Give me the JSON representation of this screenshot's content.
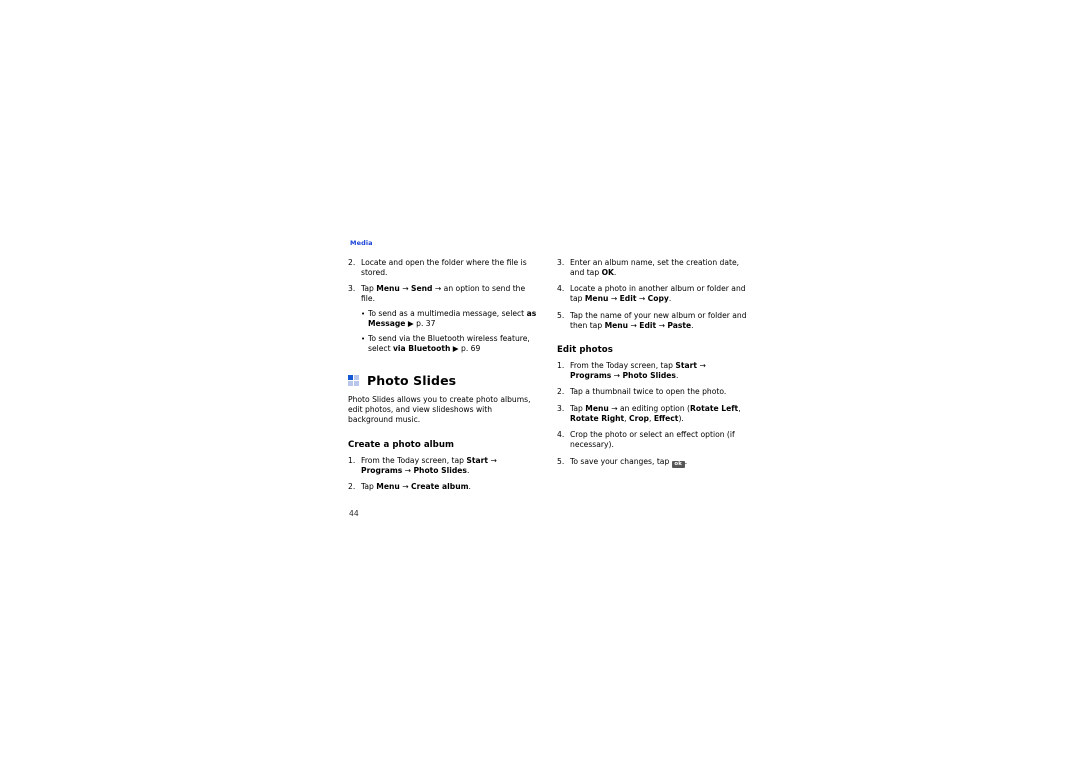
{
  "page": {
    "running_header": "Media",
    "page_number": "44"
  },
  "icons": {
    "grid_icon": "grid-2x2-icon",
    "ok_softkey": "ok",
    "arrow": "→",
    "triangle": "▶",
    "bullet": "•"
  },
  "colors": {
    "header_blue": "#1a43d8",
    "icon_blue": "#1357d6",
    "icon_blue_light": "#b9c6ec",
    "softkey_gray": "#575757",
    "text": "#000000",
    "background": "#ffffff"
  },
  "left_column": {
    "continued_steps": [
      {
        "num": "2.",
        "parts": [
          {
            "t": "Locate and open the folder where the file is stored.",
            "b": false
          }
        ]
      },
      {
        "num": "3.",
        "parts": [
          {
            "t": "Tap ",
            "b": false
          },
          {
            "t": "Menu",
            "b": true
          },
          {
            "t": " → ",
            "b": false
          },
          {
            "t": "Send",
            "b": true
          },
          {
            "t": " → an option to send the file.",
            "b": false
          }
        ],
        "subs": [
          {
            "parts": [
              {
                "t": "To send as a multimedia message, select ",
                "b": false
              },
              {
                "t": "as Message",
                "b": true
              },
              {
                "t": " ▶ p. 37",
                "b": false
              }
            ]
          },
          {
            "parts": [
              {
                "t": "To send via the Bluetooth wireless feature, select ",
                "b": false
              },
              {
                "t": "via Bluetooth",
                "b": true
              },
              {
                "t": " ▶ p. 69",
                "b": false
              }
            ]
          }
        ]
      }
    ],
    "chapter": {
      "title": "Photo Slides",
      "intro": "Photo Slides allows you to create photo albums, edit photos, and view slideshows with background music."
    },
    "section": {
      "heading": "Create a photo album",
      "steps": [
        {
          "num": "1.",
          "parts": [
            {
              "t": "From the Today screen, tap ",
              "b": false
            },
            {
              "t": "Start",
              "b": true
            },
            {
              "t": " → ",
              "b": false
            },
            {
              "t": "Programs",
              "b": true
            },
            {
              "t": " → ",
              "b": false
            },
            {
              "t": "Photo Slides",
              "b": true
            },
            {
              "t": ".",
              "b": false
            }
          ]
        },
        {
          "num": "2.",
          "parts": [
            {
              "t": "Tap ",
              "b": false
            },
            {
              "t": "Menu",
              "b": true
            },
            {
              "t": " → ",
              "b": false
            },
            {
              "t": "Create album",
              "b": true
            },
            {
              "t": ".",
              "b": false
            }
          ]
        }
      ]
    }
  },
  "right_column": {
    "continued_steps": [
      {
        "num": "3.",
        "parts": [
          {
            "t": "Enter an album name, set the creation date, and tap ",
            "b": false
          },
          {
            "t": "OK",
            "b": true
          },
          {
            "t": ".",
            "b": false
          }
        ]
      },
      {
        "num": "4.",
        "parts": [
          {
            "t": "Locate a photo in another album or folder and tap ",
            "b": false
          },
          {
            "t": "Menu",
            "b": true
          },
          {
            "t": " → ",
            "b": false
          },
          {
            "t": "Edit",
            "b": true
          },
          {
            "t": " → ",
            "b": false
          },
          {
            "t": "Copy",
            "b": true
          },
          {
            "t": ".",
            "b": false
          }
        ]
      },
      {
        "num": "5.",
        "parts": [
          {
            "t": "Tap the name of your new album or folder and then tap ",
            "b": false
          },
          {
            "t": "Menu",
            "b": true
          },
          {
            "t": " → ",
            "b": false
          },
          {
            "t": "Edit",
            "b": true
          },
          {
            "t": " → ",
            "b": false
          },
          {
            "t": "Paste",
            "b": true
          },
          {
            "t": ".",
            "b": false
          }
        ]
      }
    ],
    "section": {
      "heading": "Edit photos",
      "steps": [
        {
          "num": "1.",
          "parts": [
            {
              "t": "From the Today screen, tap ",
              "b": false
            },
            {
              "t": "Start",
              "b": true
            },
            {
              "t": " → ",
              "b": false
            },
            {
              "t": "Programs",
              "b": true
            },
            {
              "t": " → ",
              "b": false
            },
            {
              "t": "Photo Slides",
              "b": true
            },
            {
              "t": ".",
              "b": false
            }
          ]
        },
        {
          "num": "2.",
          "parts": [
            {
              "t": "Tap a thumbnail twice to open the photo.",
              "b": false
            }
          ]
        },
        {
          "num": "3.",
          "parts": [
            {
              "t": "Tap ",
              "b": false
            },
            {
              "t": "Menu",
              "b": true
            },
            {
              "t": " → an editing option (",
              "b": false
            },
            {
              "t": "Rotate Left",
              "b": true
            },
            {
              "t": ", ",
              "b": false
            },
            {
              "t": "Rotate Right",
              "b": true
            },
            {
              "t": ", ",
              "b": false
            },
            {
              "t": "Crop",
              "b": true
            },
            {
              "t": ", ",
              "b": false
            },
            {
              "t": "Effect",
              "b": true
            },
            {
              "t": ").",
              "b": false
            }
          ]
        },
        {
          "num": "4.",
          "parts": [
            {
              "t": "Crop the photo or select an effect option (if necessary).",
              "b": false
            }
          ]
        },
        {
          "num": "5.",
          "parts": [
            {
              "t": "To save your changes, tap ",
              "b": false
            },
            {
              "t": "__OK_KEY__",
              "b": false,
              "key": "ok"
            },
            {
              "t": ".",
              "b": false
            }
          ]
        }
      ]
    }
  }
}
